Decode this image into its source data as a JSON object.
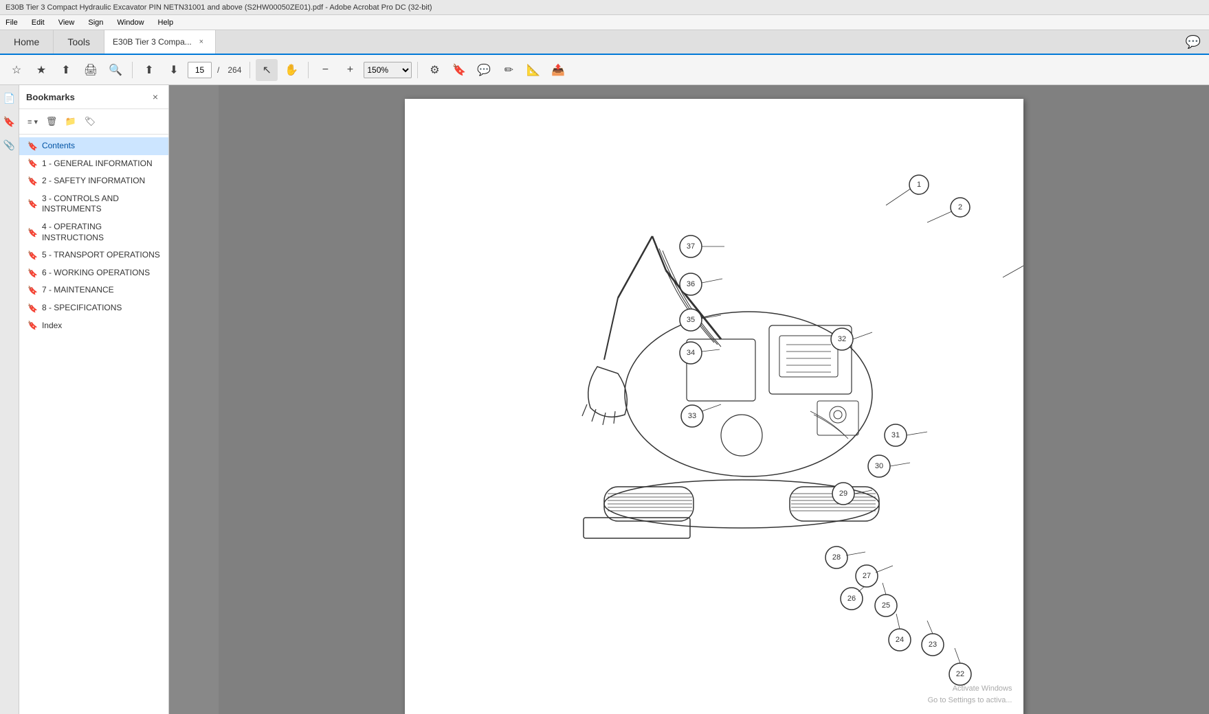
{
  "titlebar": {
    "text": "E30B Tier 3 Compact Hydraulic Excavator PIN NETN31001 and above (S2HW00050ZE01).pdf - Adobe Acrobat Pro DC (32-bit)"
  },
  "menubar": {
    "items": [
      "File",
      "Edit",
      "View",
      "Sign",
      "Window",
      "Help"
    ]
  },
  "tabs": {
    "home_label": "Home",
    "tools_label": "Tools",
    "doc_tab_label": "E30B Tier 3 Compa...",
    "doc_tab_close": "×"
  },
  "toolbar": {
    "page_current": "15",
    "page_total": "264",
    "zoom_value": "150%"
  },
  "bookmarks": {
    "title": "Bookmarks",
    "close_icon": "×",
    "items": [
      {
        "label": "Contents",
        "active": true
      },
      {
        "label": "1 - GENERAL INFORMATION",
        "active": false
      },
      {
        "label": "2 - SAFETY INFORMATION",
        "active": false
      },
      {
        "label": "3 - CONTROLS AND INSTRUMENTS",
        "active": false
      },
      {
        "label": "4 - OPERATING INSTRUCTIONS",
        "active": false
      },
      {
        "label": "5 - TRANSPORT OPERATIONS",
        "active": false
      },
      {
        "label": "6 - WORKING OPERATIONS",
        "active": false
      },
      {
        "label": "7 - MAINTENANCE",
        "active": false
      },
      {
        "label": "8 - SPECIFICATIONS",
        "active": false
      },
      {
        "label": "Index",
        "active": false
      }
    ]
  },
  "windows_watermark": {
    "line1": "Activate Windows",
    "line2": "Go to Settings to activa..."
  }
}
